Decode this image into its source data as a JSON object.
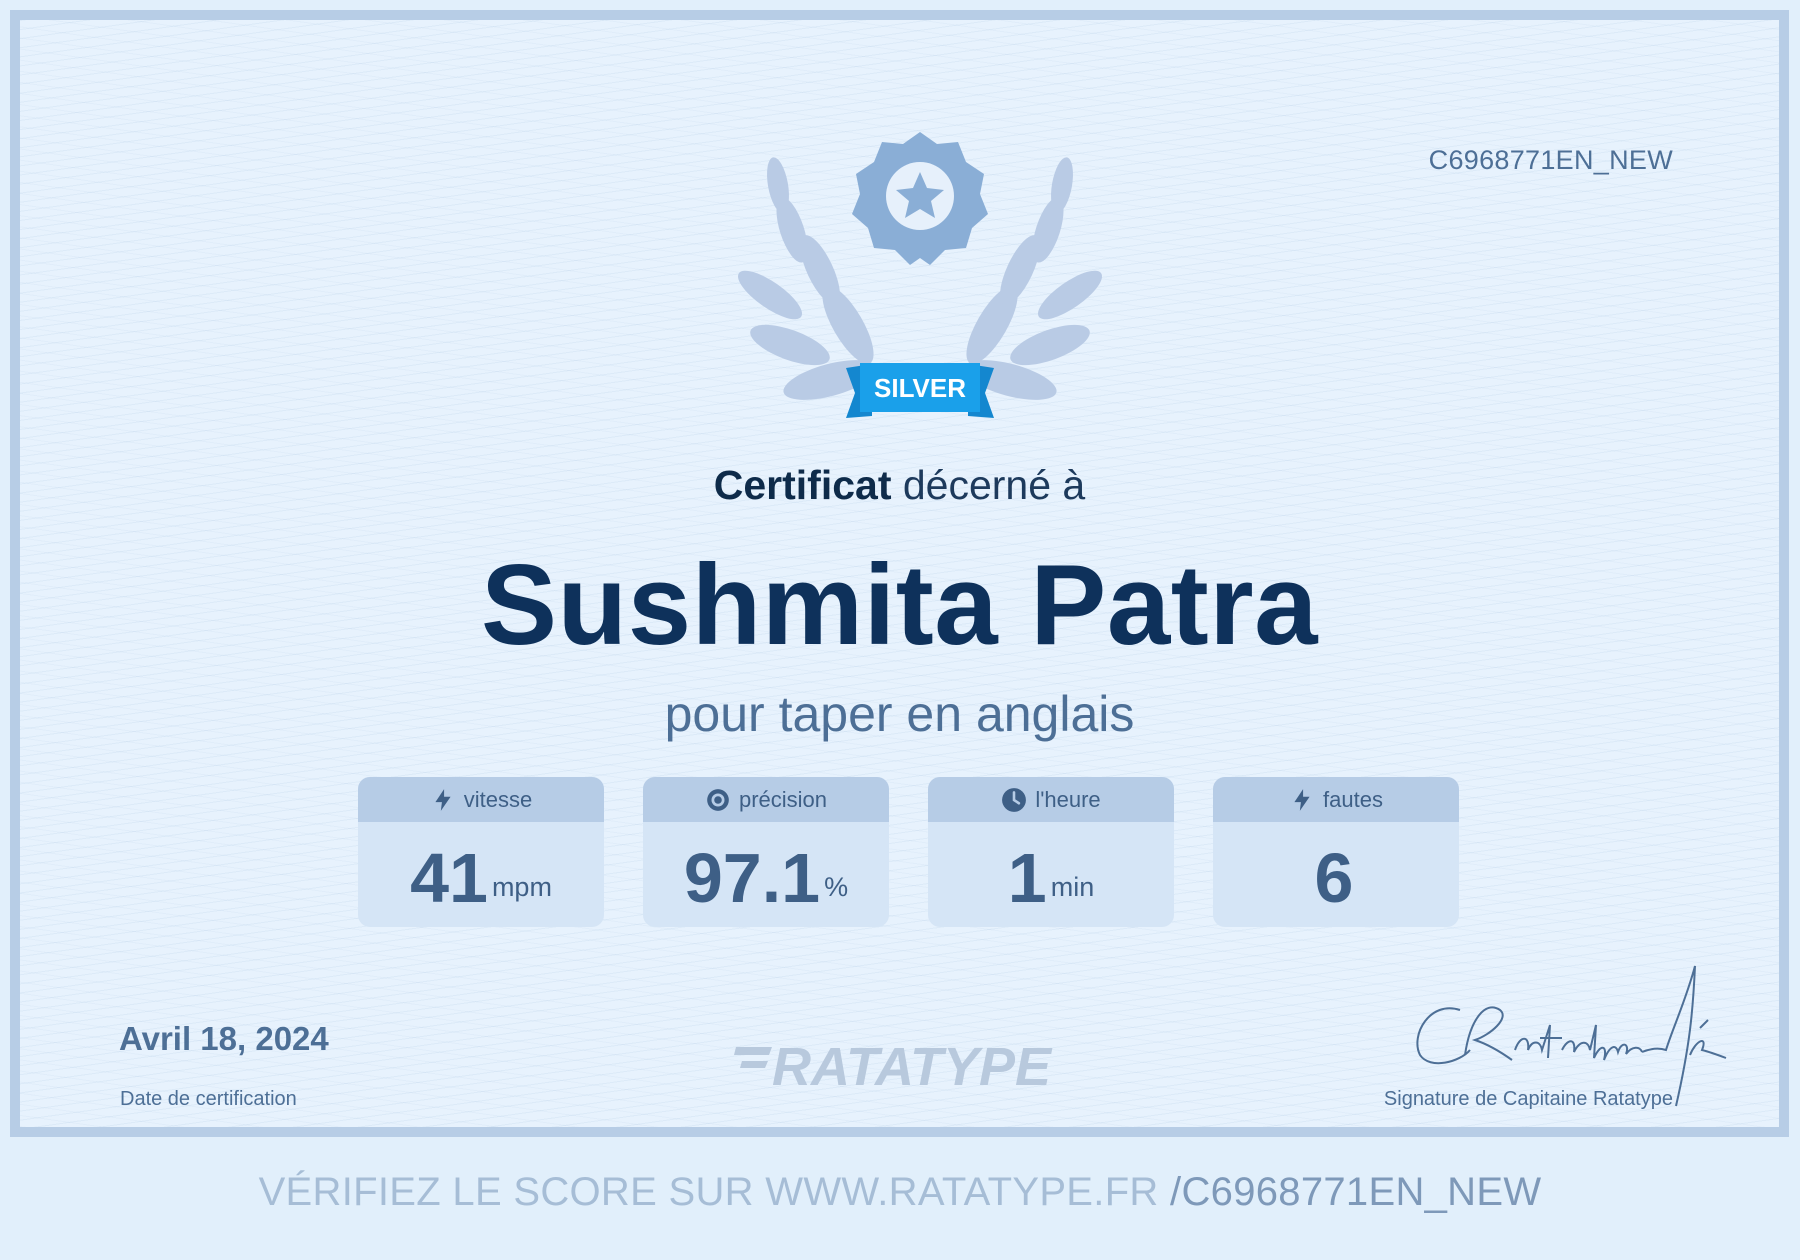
{
  "certificate": {
    "code": "C6968771EN_NEW",
    "badge_label": "SILVER",
    "title_bold": "Certificat",
    "title_rest": " décerné à",
    "recipient_name": "Sushmita Patra",
    "subtitle": "pour taper en anglais",
    "stats": [
      {
        "label": "vitesse",
        "icon": "lightning-icon",
        "value": "41",
        "unit": "mpm"
      },
      {
        "label": "précision",
        "icon": "target-icon",
        "value": "97.1",
        "unit": "%"
      },
      {
        "label": "l'heure",
        "icon": "clock-icon",
        "value": "1",
        "unit": "min"
      },
      {
        "label": "fautes",
        "icon": "lightning-icon",
        "value": "6",
        "unit": ""
      }
    ],
    "date": "Avril 18, 2024",
    "date_label": "Date de certification",
    "logo_text": "RATATYPE",
    "signature_label": "Signature de Capitaine Ratatype"
  },
  "footer": {
    "prefix": "VÉRIFIEZ LE SCORE SUR WWW.RATATYPE.FR ",
    "code": "/C6968771EN_NEW"
  },
  "colors": {
    "border": "#b7cde6",
    "name": "#0e315b",
    "badge": "#1aa0ea",
    "accent": "#4d6f96"
  }
}
